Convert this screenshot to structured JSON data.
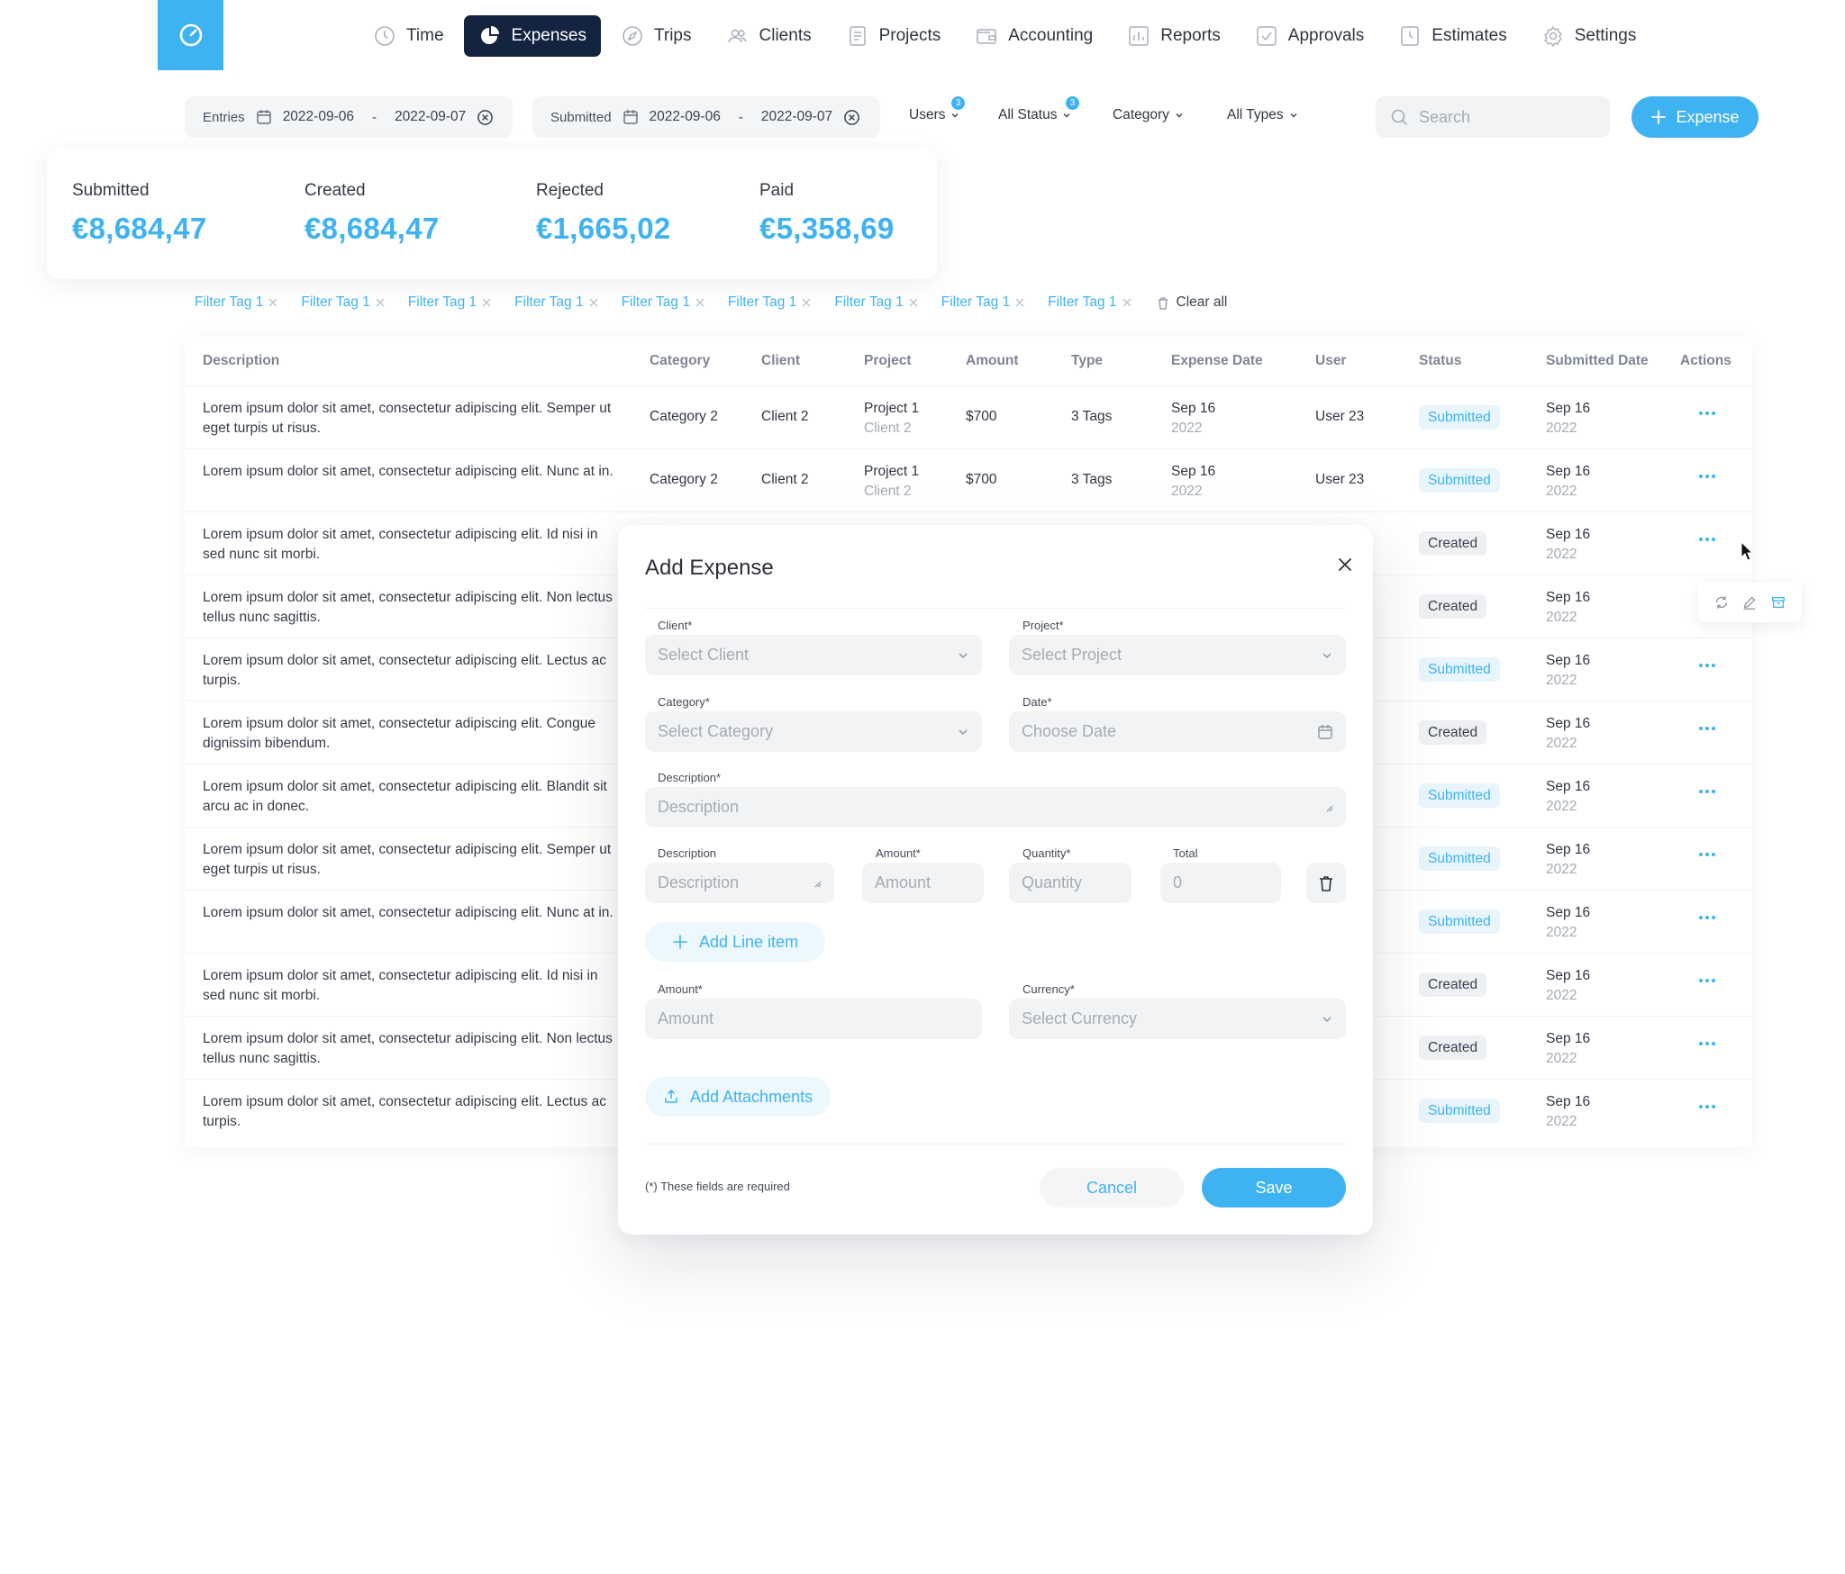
{
  "nav": {
    "items": [
      {
        "label": "Time",
        "icon": "clock-icon",
        "active": false
      },
      {
        "label": "Expenses",
        "icon": "pie-chart-icon",
        "active": true
      },
      {
        "label": "Trips",
        "icon": "compass-icon",
        "active": false
      },
      {
        "label": "Clients",
        "icon": "users-icon",
        "active": false
      },
      {
        "label": "Projects",
        "icon": "document-icon",
        "active": false
      },
      {
        "label": "Accounting",
        "icon": "wallet-icon",
        "active": false
      },
      {
        "label": "Reports",
        "icon": "bar-chart-icon",
        "active": false
      },
      {
        "label": "Approvals",
        "icon": "check-square-icon",
        "active": false
      },
      {
        "label": "Estimates",
        "icon": "clock-file-icon",
        "active": false
      },
      {
        "label": "Settings",
        "icon": "gear-icon",
        "active": false
      }
    ]
  },
  "filters": {
    "entries": {
      "label": "Entries",
      "from": "2022-09-06",
      "sep": "-",
      "to": "2022-09-07"
    },
    "submitted": {
      "label": "Submitted",
      "from": "2022-09-06",
      "sep": "-",
      "to": "2022-09-07"
    },
    "users": {
      "label": "Users",
      "badge": "3"
    },
    "status": {
      "label": "All Status",
      "badge": "3"
    },
    "category": {
      "label": "Category"
    },
    "types": {
      "label": "All Types"
    },
    "search_placeholder": "Search",
    "add_expense": "Expense"
  },
  "stats": [
    {
      "label": "Submitted",
      "value": "€8,684,47"
    },
    {
      "label": "Created",
      "value": "€8,684,47"
    },
    {
      "label": "Rejected",
      "value": "€1,665,02"
    },
    {
      "label": "Paid",
      "value": "€5,358,69"
    }
  ],
  "tags": [
    "Filter Tag 1",
    "Filter Tag 1",
    "Filter Tag 1",
    "Filter Tag 1",
    "Filter Tag 1",
    "Filter Tag 1",
    "Filter Tag 1",
    "Filter Tag 1",
    "Filter Tag 1"
  ],
  "clear_all": "Clear all",
  "table": {
    "columns": [
      "Description",
      "Category",
      "Client",
      "Project",
      "Amount",
      "Type",
      "Expense Date",
      "User",
      "Status",
      "Submitted Date",
      "Actions"
    ],
    "rows": [
      {
        "desc": "Lorem ipsum dolor sit amet, consectetur adipiscing elit. Semper ut eget turpis ut risus.",
        "category": "Category 2",
        "client": "Client 2",
        "project": "Project 1",
        "project_client": "Client 2",
        "amount": "$700",
        "type": "3 Tags",
        "date": "Sep 16",
        "year": "2022",
        "user": "User 23",
        "status": "Submitted",
        "sub_date": "Sep 16",
        "sub_year": "2022"
      },
      {
        "desc": "Lorem ipsum dolor sit amet, consectetur adipiscing elit. Nunc at in.",
        "category": "Category 2",
        "client": "Client 2",
        "project": "Project 1",
        "project_client": "Client 2",
        "amount": "$700",
        "type": "3 Tags",
        "date": "Sep 16",
        "year": "2022",
        "user": "User 23",
        "status": "Submitted",
        "sub_date": "Sep 16",
        "sub_year": "2022"
      },
      {
        "desc": "Lorem ipsum dolor sit amet, consectetur adipiscing elit. Id nisi in sed nunc sit morbi.",
        "status": "Created",
        "sub_date": "Sep 16",
        "sub_year": "2022"
      },
      {
        "desc": "Lorem ipsum dolor sit amet, consectetur adipiscing elit. Non lectus tellus nunc sagittis.",
        "status": "Created",
        "sub_date": "Sep 16",
        "sub_year": "2022"
      },
      {
        "desc": "Lorem ipsum dolor sit amet, consectetur adipiscing elit. Lectus ac turpis.",
        "status": "Submitted",
        "sub_date": "Sep 16",
        "sub_year": "2022"
      },
      {
        "desc": "Lorem ipsum dolor sit amet, consectetur adipiscing elit. Congue dignissim bibendum.",
        "status": "Created",
        "sub_date": "Sep 16",
        "sub_year": "2022"
      },
      {
        "desc": "Lorem ipsum dolor sit amet, consectetur adipiscing elit. Blandit sit arcu ac in donec.",
        "status": "Submitted",
        "sub_date": "Sep 16",
        "sub_year": "2022"
      },
      {
        "desc": "Lorem ipsum dolor sit amet, consectetur adipiscing elit. Semper ut eget turpis ut risus.",
        "status": "Submitted",
        "sub_date": "Sep 16",
        "sub_year": "2022"
      },
      {
        "desc": "Lorem ipsum dolor sit amet, consectetur adipiscing elit. Nunc at in.",
        "status": "Submitted",
        "sub_date": "Sep 16",
        "sub_year": "2022"
      },
      {
        "desc": "Lorem ipsum dolor sit amet, consectetur adipiscing elit. Id nisi in sed nunc sit morbi.",
        "status": "Created",
        "sub_date": "Sep 16",
        "sub_year": "2022"
      },
      {
        "desc": "Lorem ipsum dolor sit amet, consectetur adipiscing elit. Non lectus tellus nunc sagittis.",
        "status": "Created",
        "sub_date": "Sep 16",
        "sub_year": "2022"
      },
      {
        "desc": "Lorem ipsum dolor sit amet, consectetur adipiscing elit. Lectus ac turpis.",
        "status": "Submitted",
        "sub_date": "Sep 16",
        "sub_year": "2022"
      }
    ]
  },
  "modal": {
    "title": "Add Expense",
    "client_label": "Client*",
    "client_placeholder": "Select Client",
    "project_label": "Project*",
    "project_placeholder": "Select Project",
    "category_label": "Category*",
    "category_placeholder": "Select Category",
    "date_label": "Date*",
    "date_placeholder": "Choose Date",
    "description_label": "Description*",
    "description_placeholder": "Description",
    "line": {
      "desc_label": "Description",
      "desc_placeholder": "Description",
      "amount_label": "Amount*",
      "amount_placeholder": "Amount",
      "qty_label": "Quantity*",
      "qty_placeholder": "Quantity",
      "total_label": "Total",
      "total_value": "0"
    },
    "add_line": "Add Line item",
    "amount_label": "Amount*",
    "amount_placeholder": "Amount",
    "currency_label": "Currency*",
    "currency_placeholder": "Select Currency",
    "add_attachments": "Add Attachments",
    "required_note": "(*) These fields are required",
    "cancel": "Cancel",
    "save": "Save"
  },
  "colors": {
    "accent": "#3fb2f2",
    "nav_active": "#132340"
  }
}
